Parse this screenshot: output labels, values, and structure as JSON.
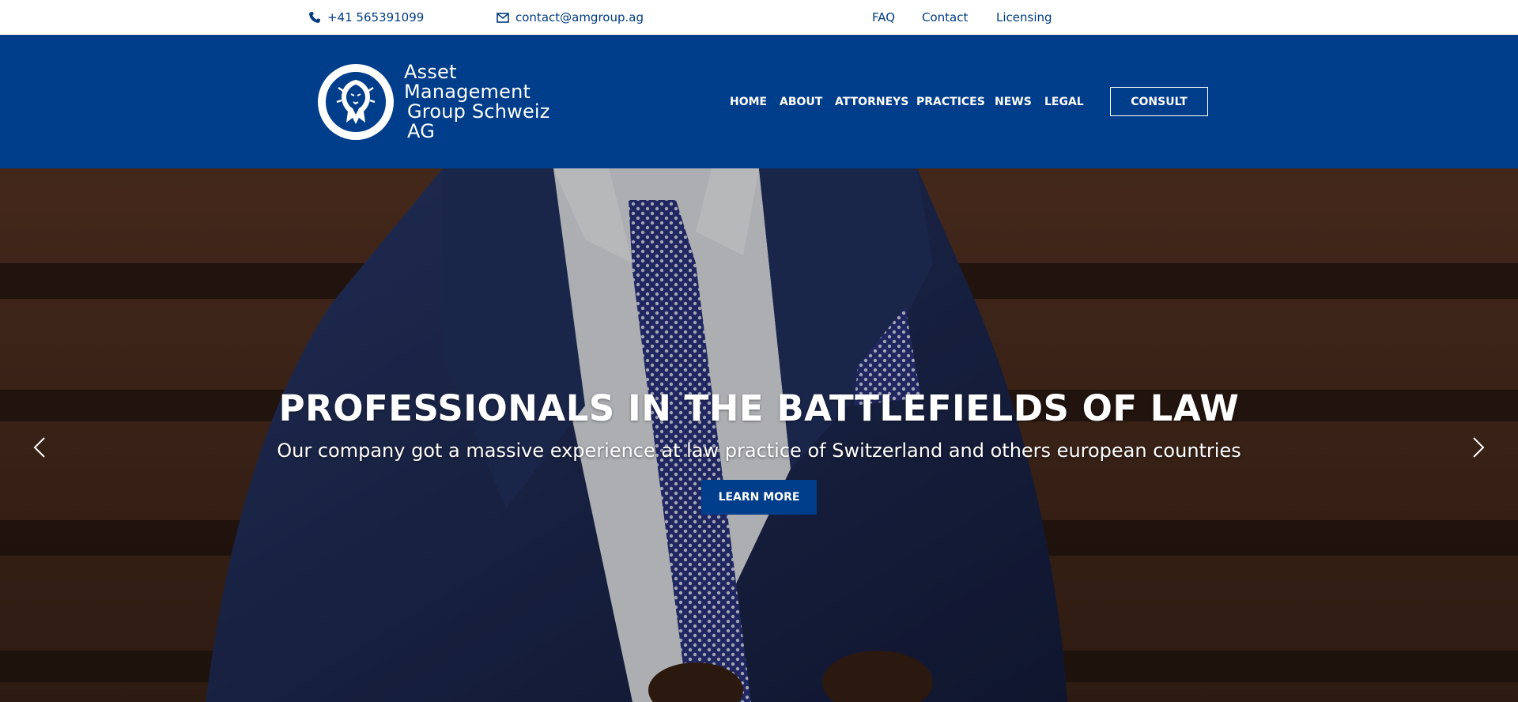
{
  "topbar": {
    "phone": "+41 565391099",
    "email": "contact@amgroup.ag",
    "links": [
      "FAQ",
      "Contact",
      "Licensing"
    ],
    "phone_icon": "phone-icon",
    "email_icon": "envelope-icon"
  },
  "header": {
    "logo_line1": "Asset Management",
    "logo_line2": "Group Schweiz AG",
    "logo_icon": "lion-icon",
    "nav": [
      "HOME",
      "ABOUT",
      "ATTORNEYS",
      "PRACTICES",
      "NEWS",
      "LEGAL"
    ],
    "consult_label": "CONSULT"
  },
  "hero": {
    "title": "PROFESSIONALS IN THE BATTLEFIELDS OF LAW",
    "subtitle": "Our company got a massive experience at law practice of Switzerland and others european countries",
    "button_label": "LEARN MORE",
    "prev_icon": "chevron-left-icon",
    "next_icon": "chevron-right-icon"
  },
  "colors": {
    "brand": "#003d8a",
    "topbar_text": "#003b7e",
    "white": "#ffffff"
  }
}
